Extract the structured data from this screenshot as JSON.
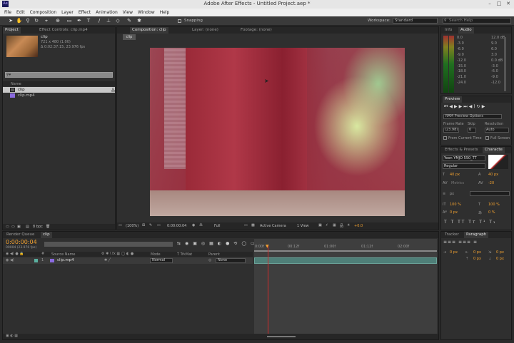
{
  "window": {
    "title": "Adobe After Effects - Untitled Project.aep *",
    "app_icon": "Ae"
  },
  "menu": [
    "File",
    "Edit",
    "Composition",
    "Layer",
    "Effect",
    "Animation",
    "View",
    "Window",
    "Help"
  ],
  "toolbar": {
    "snapping": "Snapping",
    "workspace_label": "Workspace:",
    "workspace_value": "Standard",
    "search_placeholder": "Search Help"
  },
  "project": {
    "tab_project": "Project",
    "tab_effect": "Effect Controls: clip.mp4",
    "item_name": "clip",
    "item_dims": "721 x 480 (1.00)",
    "item_duration": "Δ 0:02:37:15, 23.976 fps",
    "column_name": "Name",
    "items": [
      "clip",
      "clip.mp4"
    ],
    "bpc": "8 bpc"
  },
  "composition": {
    "tab": "Composition: clip",
    "layer_tab": "Layer: (none)",
    "footage_tab": "Footage: (none)",
    "subtab": "clip",
    "zoom": "(100%)",
    "timecode": "0:00:00:04",
    "resolution": "Full",
    "camera": "Active Camera",
    "view": "1 View",
    "offset": "+0.0"
  },
  "info": {
    "tab_info": "Info",
    "tab_audio": "Audio",
    "db_left": [
      "0.0",
      "-3.0",
      "-6.0",
      "-9.0",
      "-12.0",
      "-15.0",
      "-18.0",
      "-21.0",
      "-24.0"
    ],
    "db_right": [
      "12.0 dB",
      "9.0",
      "6.0",
      "3.0",
      "0.0 dB",
      "-3.0",
      "-6.0",
      "-9.0",
      "-12.0"
    ]
  },
  "preview": {
    "tab": "Preview",
    "ram_preview": "RAM Preview Options",
    "frame_rate_label": "Frame Rate",
    "skip_label": "Skip",
    "resolution_label": "Resolution",
    "frame_rate": "(23.98)",
    "skip": "0",
    "resolution": "Auto",
    "from_current": "From Current Time",
    "full_screen": "Full Screen"
  },
  "effects": {
    "tab": "Effects & Presets",
    "character_tab": "Characte",
    "font": "Yoon YMJO 550_TT",
    "style": "Regular",
    "size": "40 px",
    "leading": "40 px",
    "tracking": "-20",
    "kerning": "Metrics",
    "stroke_unit": "px",
    "scale_v": "100 %",
    "scale_h": "100 %",
    "baseline": "0 px",
    "tsume": "0 %"
  },
  "paragraph": {
    "tab_tracker": "Tracker",
    "tab_paragraph": "Paragraph",
    "indent_values": [
      "0 px",
      "0 px",
      "0 px",
      "0 px",
      "0 px"
    ]
  },
  "timeline": {
    "tab_render": "Render Queue",
    "tab_comp": "clip",
    "timecode": "0:00:00:04",
    "fps_line": "00004 (23.976 fps)",
    "col_source": "Source Name",
    "col_mode": "Mode",
    "col_trkmat": "TrkMat",
    "col_parent": "Parent",
    "layer_num": "1",
    "layer_name": "clip.mp4",
    "layer_mode": "Normal",
    "layer_parent": "None",
    "ruler": [
      "0:00f",
      "00:12f",
      "01:00f",
      "01:12f",
      "02:00f"
    ]
  },
  "colors": {
    "accent": "#f0a030",
    "timeline_bar": "#4f7f78",
    "playhead": "#d22b2b"
  }
}
